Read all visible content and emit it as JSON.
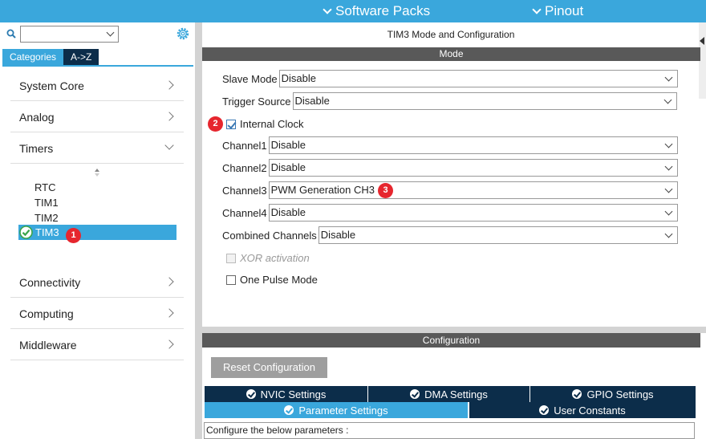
{
  "topbar": {
    "software_packs": "Software Packs",
    "pinout": "Pinout"
  },
  "left": {
    "search": {
      "value": ""
    },
    "tabs": [
      "Categories",
      "A->Z"
    ],
    "categories": {
      "system_core": "System Core",
      "analog": "Analog",
      "timers": "Timers",
      "connectivity": "Connectivity",
      "computing": "Computing",
      "middleware": "Middleware"
    },
    "timers": [
      "RTC",
      "TIM1",
      "TIM2",
      "TIM3"
    ]
  },
  "badges": {
    "one": "1",
    "two": "2",
    "three": "3"
  },
  "right": {
    "title": "TIM3 Mode and Configuration",
    "mode_header": "Mode",
    "slave_mode": {
      "label": "Slave Mode",
      "value": "Disable"
    },
    "trigger_source": {
      "label": "Trigger Source",
      "value": "Disable"
    },
    "internal_clock": {
      "label": "Internal Clock",
      "checked": true
    },
    "channel1": {
      "label": "Channel1",
      "value": "Disable"
    },
    "channel2": {
      "label": "Channel2",
      "value": "Disable"
    },
    "channel3": {
      "label": "Channel3",
      "value": "PWM Generation CH3"
    },
    "channel4": {
      "label": "Channel4",
      "value": "Disable"
    },
    "combined_channels": {
      "label": "Combined Channels",
      "value": "Disable"
    },
    "xor_activation": {
      "label": "XOR activation",
      "checked": false,
      "disabled": true
    },
    "one_pulse_mode": {
      "label": "One Pulse Mode",
      "checked": false
    },
    "config_header": "Configuration",
    "reset_button": "Reset Configuration",
    "tabs": {
      "nvic": "NVIC Settings",
      "dma": "DMA Settings",
      "gpio": "GPIO Settings",
      "parameter": "Parameter Settings",
      "user_constants": "User Constants"
    },
    "configure_text": "Configure the below parameters :"
  },
  "colors": {
    "accent": "#3aa7dc",
    "dark_navy": "#0c2d4a",
    "header_gray": "#595959",
    "badge_red": "#e6262e"
  }
}
